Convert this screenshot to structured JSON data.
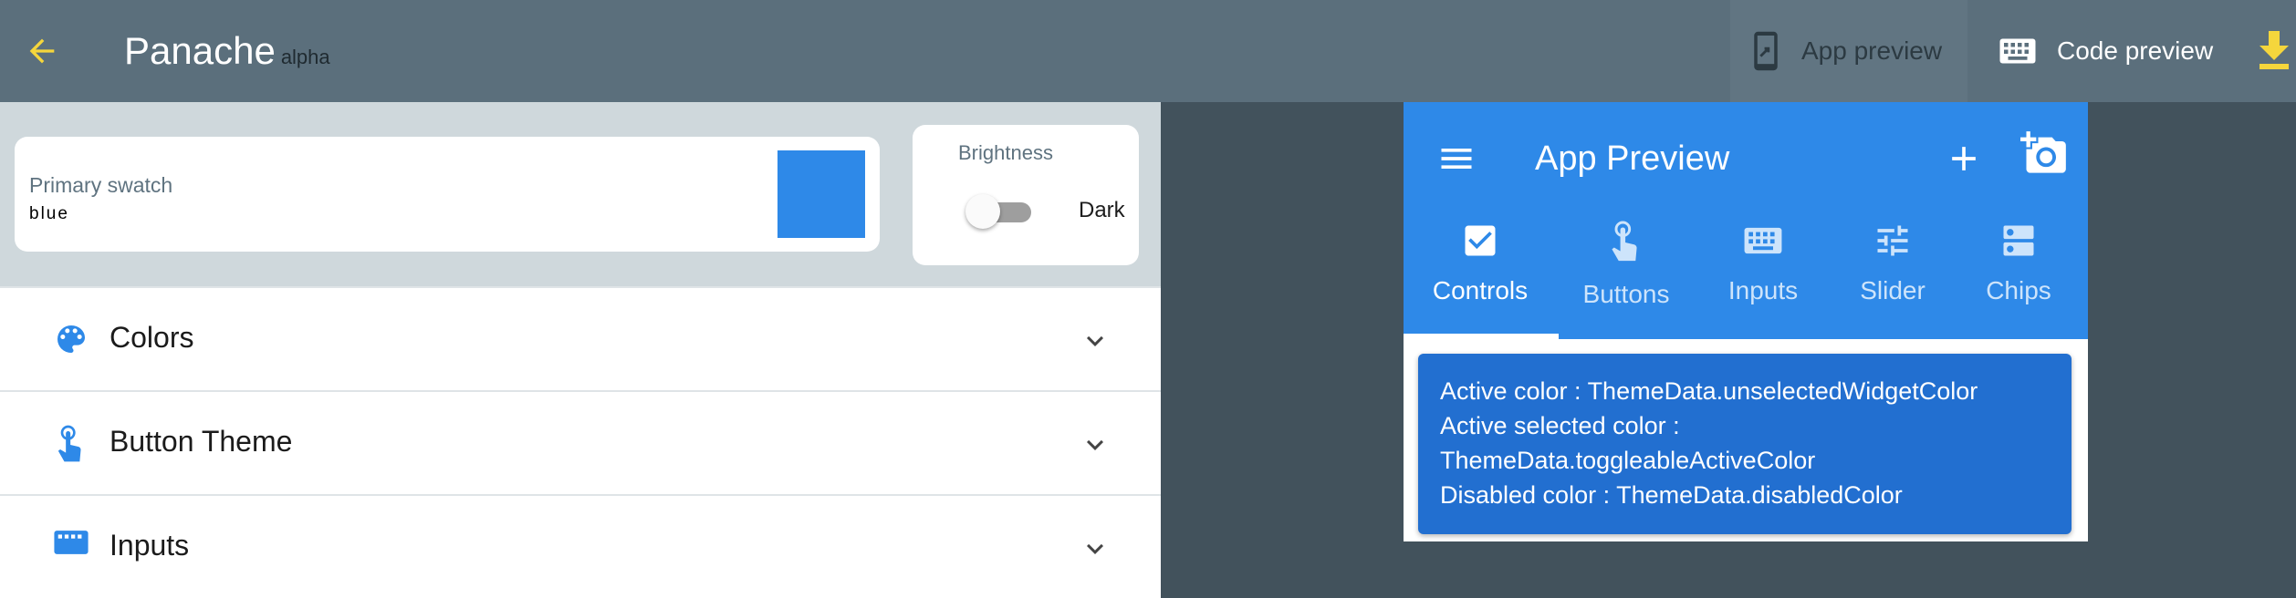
{
  "appbar": {
    "title": "Panache",
    "subtitle": "alpha",
    "actions": [
      {
        "label": "App preview",
        "icon": "phone-preview-icon"
      },
      {
        "label": "Code preview",
        "icon": "keyboard-icon"
      }
    ],
    "download_icon": "download-icon",
    "back_icon": "arrow-back-icon"
  },
  "editor": {
    "primary_swatch": {
      "label": "Primary swatch",
      "value": "blue",
      "color": "#2e89e8"
    },
    "brightness": {
      "label": "Brightness",
      "value": "Dark",
      "enabled": false
    },
    "panels": [
      {
        "label": "Colors",
        "icon": "palette-icon"
      },
      {
        "label": "Button Theme",
        "icon": "touch-icon"
      },
      {
        "label": "Inputs",
        "icon": "keyboard-icon"
      }
    ]
  },
  "preview": {
    "title": "App Preview",
    "tabs": [
      {
        "label": "Controls",
        "icon": "checkbox-icon",
        "active": true
      },
      {
        "label": "Buttons",
        "icon": "touch-icon",
        "active": false
      },
      {
        "label": "Inputs",
        "icon": "keyboard-icon",
        "active": false
      },
      {
        "label": "Slider",
        "icon": "tune-icon",
        "active": false
      },
      {
        "label": "Chips",
        "icon": "dns-icon",
        "active": false
      }
    ],
    "info_lines": [
      "Active color : ThemeData.unselectedWidgetColor",
      "Active selected color :",
      "ThemeData.toggleableActiveColor",
      "Disabled color : ThemeData.disabledColor"
    ]
  },
  "colors": {
    "appbar": "#5b6f7c",
    "accent_yellow": "#f5d63c",
    "primary": "#2e89e8",
    "canvas": "#42525c"
  }
}
